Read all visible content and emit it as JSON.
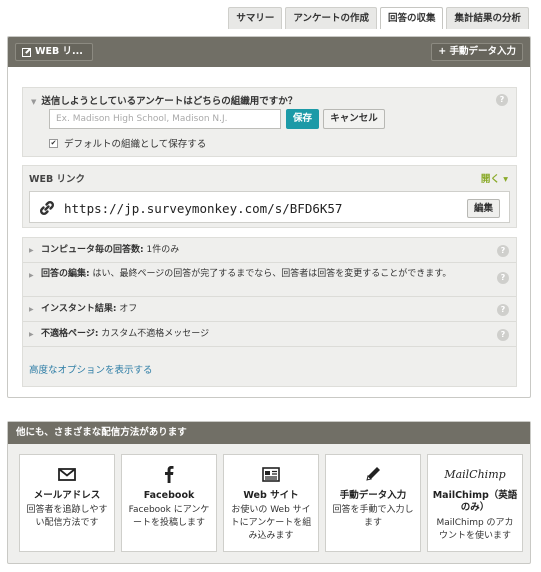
{
  "tabs": [
    "サマリー",
    "アンケートの作成",
    "回答の収集",
    "集計結果の分析"
  ],
  "active_tab": 2,
  "panel": {
    "name_button": "WEB リ...",
    "manual_entry_button": "+ 手動データ入力"
  },
  "question": {
    "title": "送信しようとしているアンケートはどちらの組織用ですか？",
    "input_placeholder": "Ex. Madison High School, Madison N.J.",
    "save_label": "保存",
    "cancel_label": "キャンセル",
    "checkbox_label": "デフォルトの組織として保存する",
    "checkbox_checked": true
  },
  "weblink": {
    "label": "WEB リンク",
    "open_label": "開く ▾",
    "url": "https://jp.surveymonkey.com/s/BFD6K57",
    "edit_label": "編集"
  },
  "options": [
    {
      "label": "コンピュータ毎の回答数:",
      "value": " 1件のみ"
    },
    {
      "label": "回答の編集:",
      "value": " はい、最終ページの回答が完了するまでなら、回答者は回答を変更することができます。"
    },
    {
      "label": "インスタント結果:",
      "value": " オフ"
    },
    {
      "label": "不適格ページ:",
      "value": " カスタム不適格メッセージ"
    }
  ],
  "advanced_link": "高度なオプションを表示する",
  "help_glyph": "?",
  "distribution": {
    "header": "他にも、さまざまな配信方法があります",
    "cards": [
      {
        "icon": "envelope-icon",
        "title": "メールアドレス",
        "desc": "回答者を追跡しやすい配信方法です"
      },
      {
        "icon": "facebook-icon",
        "title": "Facebook",
        "desc": "Facebook にアンケートを投稿します"
      },
      {
        "icon": "website-icon",
        "title": "Web サイト",
        "desc": "お使いの Web サイトにアンケートを組み込みます"
      },
      {
        "icon": "pencil-icon",
        "title": "手動データ入力",
        "desc": "回答を手動で入力します"
      },
      {
        "icon": "mailchimp-logo",
        "title": "MailChimp（英語のみ）",
        "desc": "MailChimp のアカウントを使います",
        "logo_text": "MailChimp"
      }
    ]
  }
}
